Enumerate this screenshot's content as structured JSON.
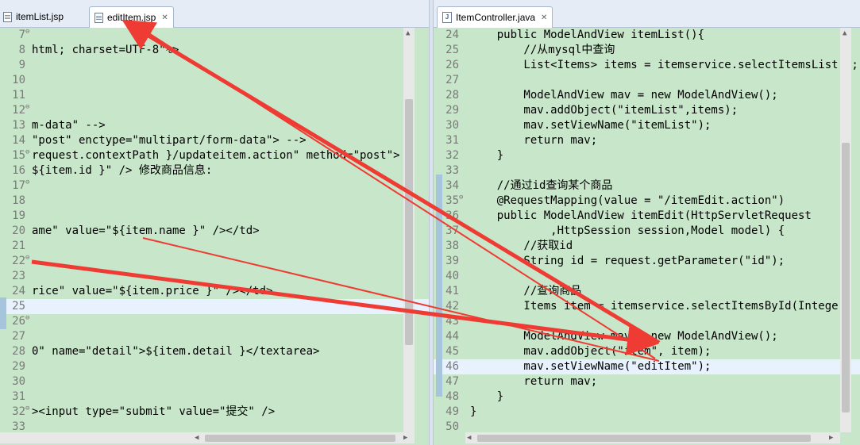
{
  "left": {
    "tabs": [
      {
        "label": "itemList.jsp",
        "active": false
      },
      {
        "label": "editItem.jsp",
        "active": true
      }
    ],
    "lines": [
      {
        "n": "7"
      },
      {
        "n": "8",
        "code": "html; charset=UTF-8\"%>"
      },
      {
        "n": "9"
      },
      {
        "n": "10"
      },
      {
        "n": "11"
      },
      {
        "n": "12"
      },
      {
        "n": "13",
        "code": "m-data\" -->"
      },
      {
        "n": "14",
        "code": "\"post\" enctype=\"multipart/form-data\"> -->"
      },
      {
        "n": "15",
        "code": "request.contextPath }/updateitem.action\" method=\"post\">"
      },
      {
        "n": "16",
        "code": "${item.id }\" /> 修改商品信息:"
      },
      {
        "n": "17"
      },
      {
        "n": "18"
      },
      {
        "n": "19"
      },
      {
        "n": "20",
        "code": "ame\" value=\"${item.name }\" /></td>"
      },
      {
        "n": "21"
      },
      {
        "n": "22"
      },
      {
        "n": "23"
      },
      {
        "n": "24",
        "code": "rice\" value=\"${item.price }\" /></td>"
      },
      {
        "n": "25"
      },
      {
        "n": "26"
      },
      {
        "n": "27"
      },
      {
        "n": "28",
        "code": "0\" name=\"detail\">${item.detail }</textarea>"
      },
      {
        "n": "29"
      },
      {
        "n": "30"
      },
      {
        "n": "31"
      },
      {
        "n": "32",
        "code": "><input type=\"submit\" value=\"提交\" />"
      },
      {
        "n": "33"
      }
    ]
  },
  "right": {
    "tabs": [
      {
        "label": "ItemController.java",
        "active": true
      }
    ],
    "lines": [
      {
        "n": "24",
        "code": "    public ModelAndView itemList(){"
      },
      {
        "n": "25",
        "code": "        //从mysql中查询"
      },
      {
        "n": "26",
        "code": "        List<Items> items = itemservice.selectItemsList();"
      },
      {
        "n": "27"
      },
      {
        "n": "28",
        "code": "        ModelAndView mav = new ModelAndView();"
      },
      {
        "n": "29",
        "code": "        mav.addObject(\"itemList\",items);"
      },
      {
        "n": "30",
        "code": "        mav.setViewName(\"itemList\");"
      },
      {
        "n": "31",
        "code": "        return mav;"
      },
      {
        "n": "32",
        "code": "    }"
      },
      {
        "n": "33"
      },
      {
        "n": "34",
        "code": "    //通过id查询某个商品"
      },
      {
        "n": "35",
        "code": "    @RequestMapping(value = \"/itemEdit.action\")"
      },
      {
        "n": "36",
        "code": "    public ModelAndView itemEdit(HttpServletRequest"
      },
      {
        "n": "37",
        "code": "            ,HttpSession session,Model model) {"
      },
      {
        "n": "38",
        "code": "        //获取id"
      },
      {
        "n": "39",
        "code": "        String id = request.getParameter(\"id\");"
      },
      {
        "n": "40"
      },
      {
        "n": "41",
        "code": "        //查询商品"
      },
      {
        "n": "42",
        "code": "        Items item = itemservice.selectItemsById(Integer"
      },
      {
        "n": "43"
      },
      {
        "n": "44",
        "code": "        ModelAndView mav = new ModelAndView();"
      },
      {
        "n": "45",
        "code": "        mav.addObject(\"item\", item);"
      },
      {
        "n": "46",
        "code": "        mav.setViewName(\"editItem\");"
      },
      {
        "n": "47",
        "code": "        return mav;"
      },
      {
        "n": "48",
        "code": "    }"
      },
      {
        "n": "49",
        "code": "}"
      },
      {
        "n": "50"
      }
    ]
  },
  "colors": {
    "editor_bg": "#c8e6c9",
    "highlight_line": "#e8f2ff",
    "annotation_arrow": "#ee3b33"
  }
}
